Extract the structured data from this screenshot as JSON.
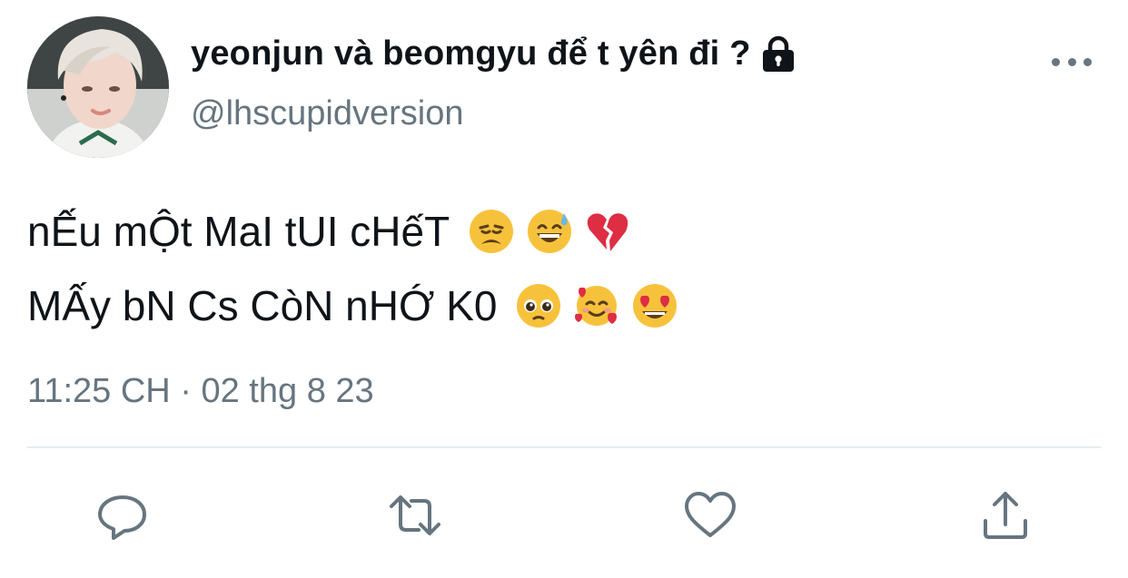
{
  "author": {
    "display_name": "yeonjun và beomgyu để t yên đi ?",
    "handle": "@lhscupidversion",
    "protected": true,
    "avatar_icon": "avatar-photo"
  },
  "tweet": {
    "lines": [
      {
        "text": "nẾu mỘt MaI tUI cHếT",
        "emojis": [
          "😩",
          "😅",
          "💔"
        ]
      },
      {
        "text": "MẤy bN Cs CòN nHỚ K0",
        "emojis": [
          "🥺",
          "🥰",
          "😍"
        ]
      }
    ],
    "timestamp": "11:25 CH · 02 thg 8 23"
  },
  "actions": [
    {
      "name": "reply",
      "icon": "comment-icon"
    },
    {
      "name": "retweet",
      "icon": "retweet-icon"
    },
    {
      "name": "like",
      "icon": "heart-icon"
    },
    {
      "name": "share",
      "icon": "share-icon"
    }
  ],
  "colors": {
    "text": "#0f1419",
    "secondary": "#66757f",
    "divider": "#e6ecf0"
  }
}
